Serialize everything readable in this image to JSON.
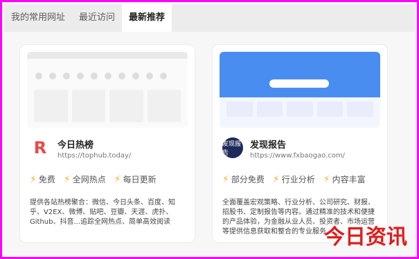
{
  "tabs": [
    {
      "label": "我的常用网址",
      "active": false
    },
    {
      "label": "最近访问",
      "active": false
    },
    {
      "label": "最新推荐",
      "active": true
    }
  ],
  "cards": [
    {
      "name": "今日热榜",
      "url": "https://tophub.today/",
      "tags": [
        "免费",
        "全网热点",
        "每日更新"
      ],
      "description": "提供各站热榜聚合：微信、今日头条、百度、知乎、V2EX、微博、贴吧、豆瓣、天涯、虎扑、Github、抖音...追踪全网热点、简单高效阅读",
      "logo": {
        "icon": "r-logo-icon",
        "color": "#e84a4a"
      }
    },
    {
      "name": "发现报告",
      "url": "https://www.fxbaogao.com/",
      "tags": [
        "部分免费",
        "行业分析",
        "内容丰富"
      ],
      "description": "全面覆盖宏观策略、行业分析、公司研究、财报、招股书、定制报告等内容。通过精准的技术和便捷的产品体验，为金融从业人员、投资者、市场运营等提供信息获取和整合的专业服务",
      "logo": {
        "text": "发现报告",
        "color": "#1e2a5a"
      }
    }
  ],
  "watermark": "今日资讯"
}
